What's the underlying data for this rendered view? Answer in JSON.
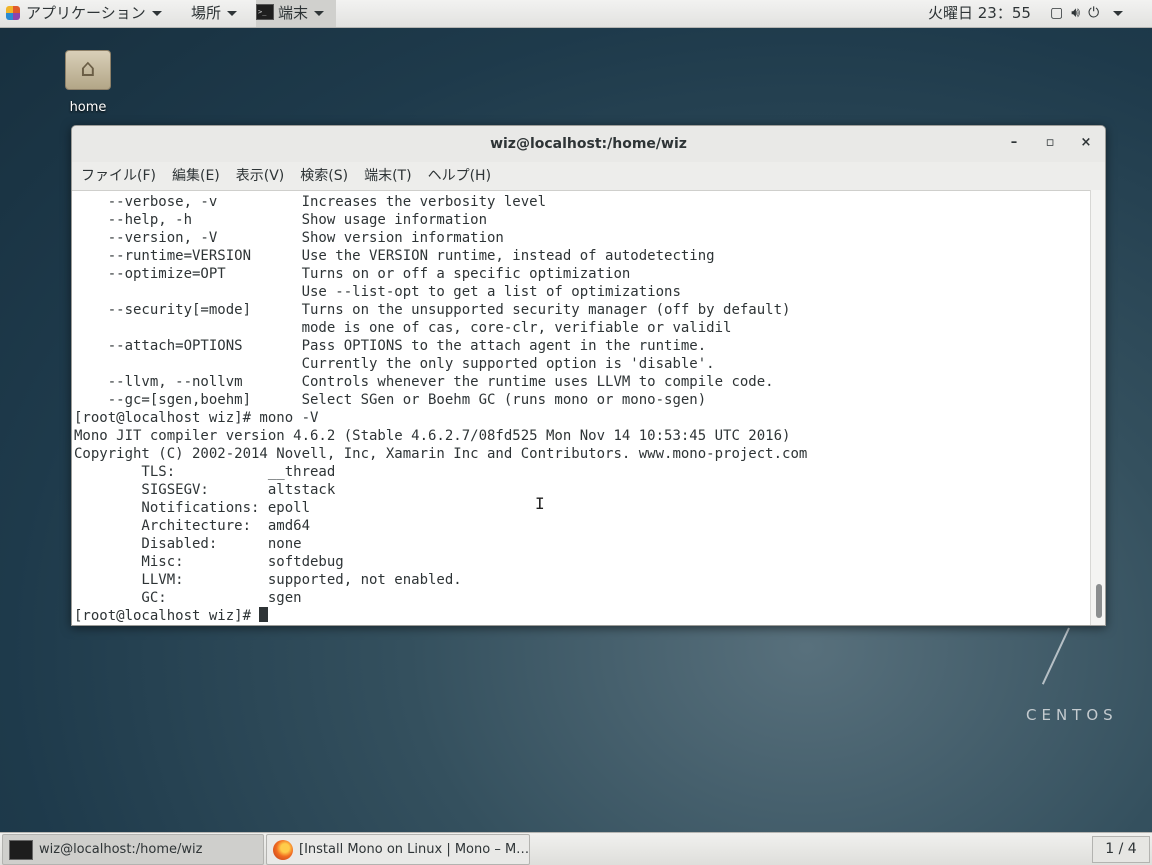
{
  "top_panel": {
    "applications": "アプリケーション",
    "places": "場所",
    "terminal": "端末",
    "clock": "火曜日 23：55",
    "tray_icons": [
      "window-icon",
      "volume-icon",
      "power-icon"
    ]
  },
  "desktop": {
    "home_label": "home",
    "brand": "CENTOS"
  },
  "window": {
    "title": "wiz@localhost:/home/wiz",
    "min_symbol": "–",
    "max_symbol": "▫",
    "close_symbol": "×",
    "menu": [
      "ファイル(F)",
      "編集(E)",
      "表示(V)",
      "検索(S)",
      "端末(T)",
      "ヘルプ(H)"
    ]
  },
  "terminal": {
    "lines": [
      "    --verbose, -v          Increases the verbosity level",
      "    --help, -h             Show usage information",
      "    --version, -V          Show version information",
      "    --runtime=VERSION      Use the VERSION runtime, instead of autodetecting",
      "    --optimize=OPT         Turns on or off a specific optimization",
      "                           Use --list-opt to get a list of optimizations",
      "    --security[=mode]      Turns on the unsupported security manager (off by default)",
      "                           mode is one of cas, core-clr, verifiable or validil",
      "    --attach=OPTIONS       Pass OPTIONS to the attach agent in the runtime.",
      "                           Currently the only supported option is 'disable'.",
      "    --llvm, --nollvm       Controls whenever the runtime uses LLVM to compile code.",
      "    --gc=[sgen,boehm]      Select SGen or Boehm GC (runs mono or mono-sgen)",
      "[root@localhost wiz]# mono -V",
      "Mono JIT compiler version 4.6.2 (Stable 4.6.2.7/08fd525 Mon Nov 14 10:53:45 UTC 2016)",
      "Copyright (C) 2002-2014 Novell, Inc, Xamarin Inc and Contributors. www.mono-project.com",
      "        TLS:           __thread",
      "        SIGSEGV:       altstack",
      "        Notifications: epoll",
      "        Architecture:  amd64",
      "        Disabled:      none",
      "        Misc:          softdebug",
      "        LLVM:          supported, not enabled.",
      "        GC:            sgen"
    ],
    "prompt": "[root@localhost wiz]# "
  },
  "taskbar": {
    "terminal_task": "wiz@localhost:/home/wiz",
    "firefox_task": "[Install Mono on Linux | Mono – M…",
    "workspace": "1 / 4"
  }
}
